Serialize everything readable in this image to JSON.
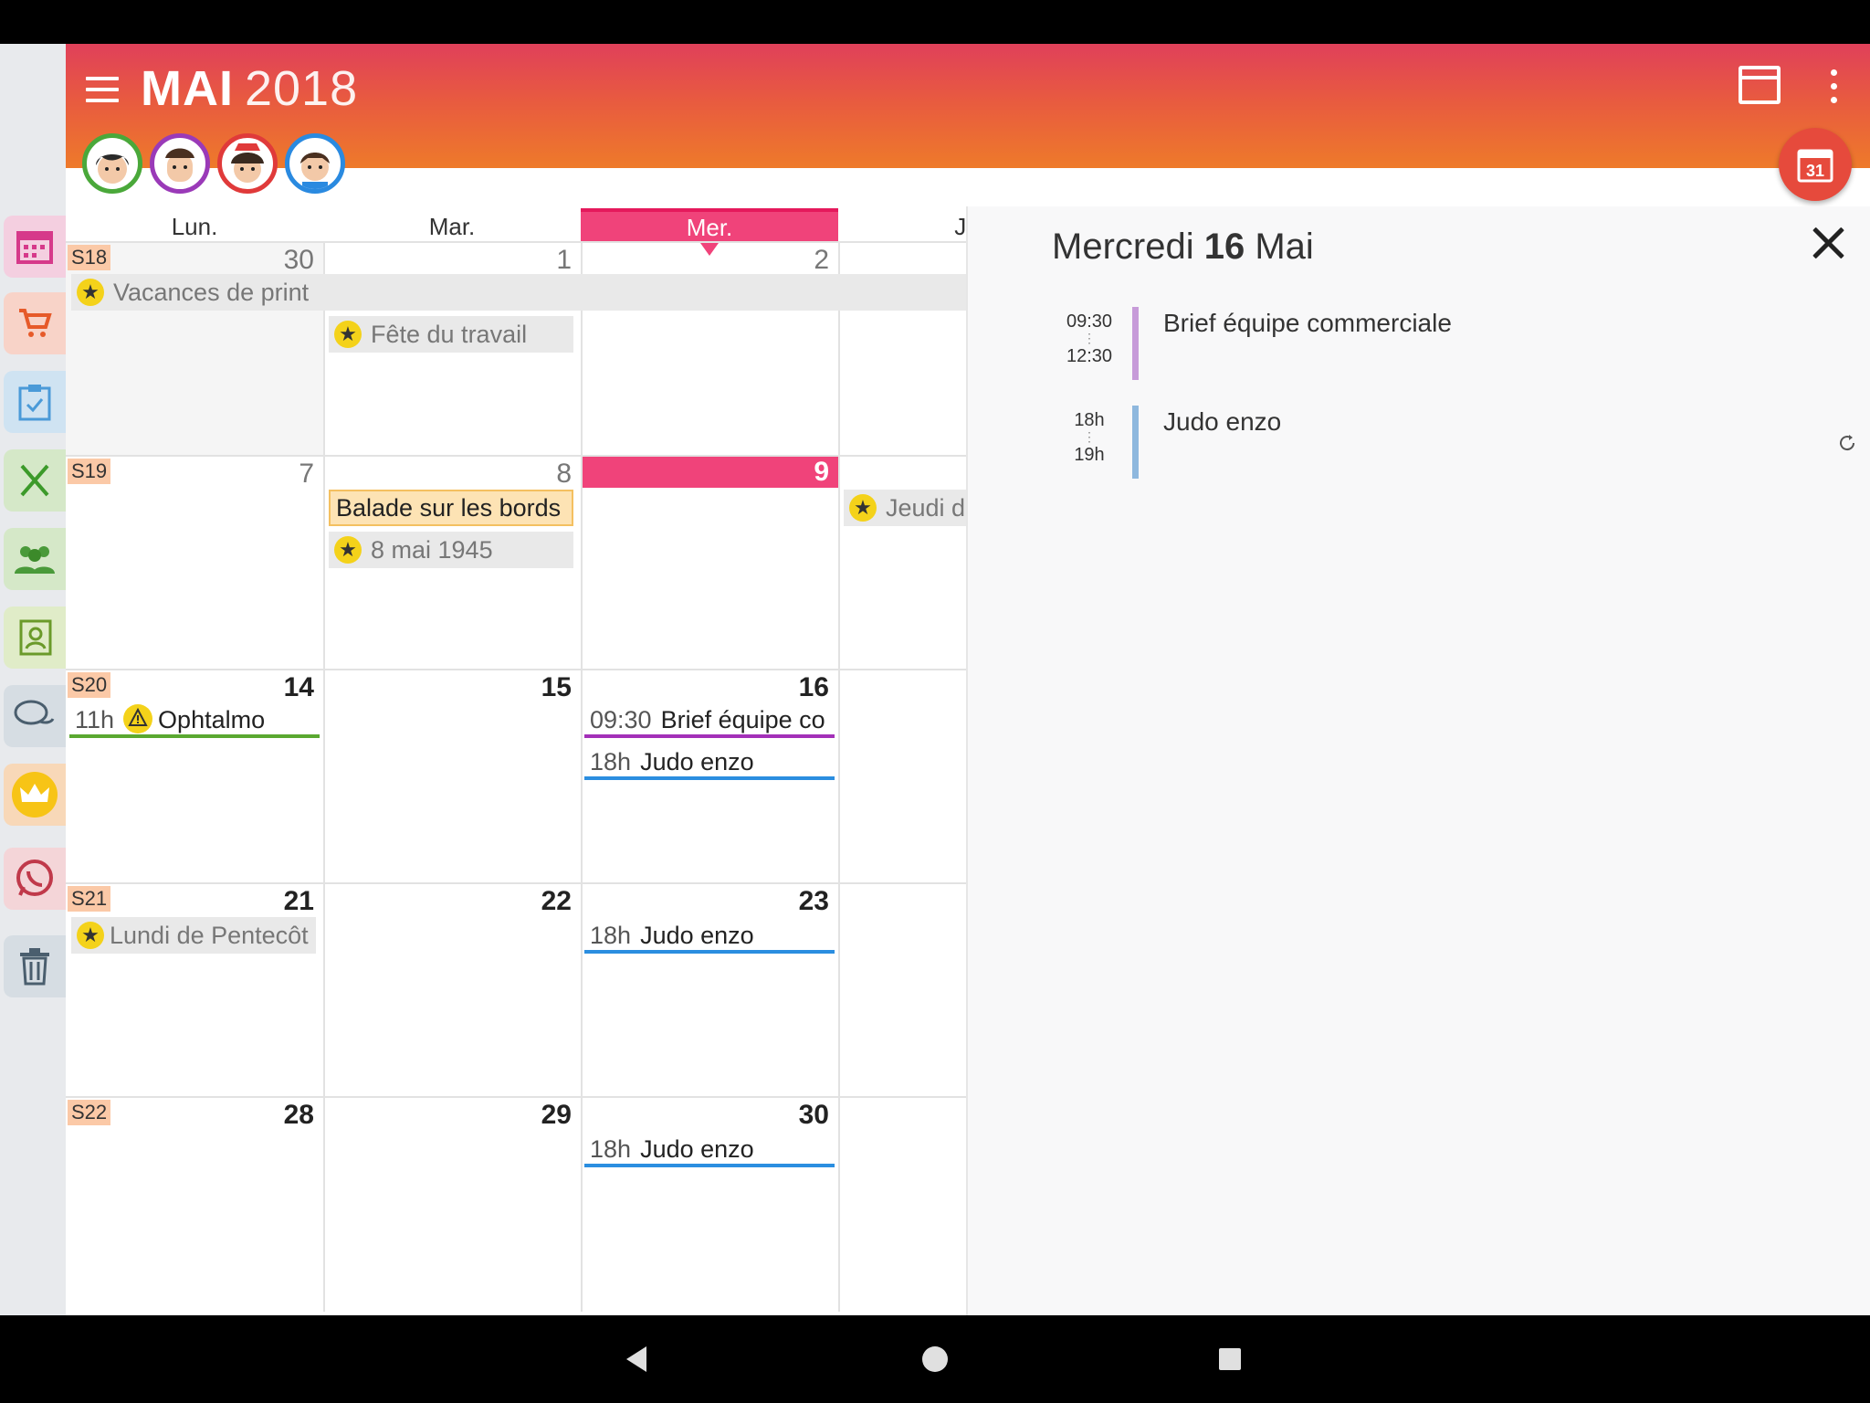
{
  "header": {
    "month": "MAI",
    "year": "2018"
  },
  "fab_calendar_day": "31",
  "day_headers": [
    "Lun.",
    "Mar.",
    "Mer.",
    "Je"
  ],
  "weeks": [
    {
      "label": "S18",
      "days": [
        "30",
        "1",
        "2",
        ""
      ]
    },
    {
      "label": "S19",
      "days": [
        "7",
        "8",
        "9",
        ""
      ]
    },
    {
      "label": "S20",
      "days": [
        "14",
        "15",
        "16",
        ""
      ]
    },
    {
      "label": "S21",
      "days": [
        "21",
        "22",
        "23",
        ""
      ]
    },
    {
      "label": "S22",
      "days": [
        "28",
        "29",
        "30",
        ""
      ]
    }
  ],
  "events": {
    "vacances": "Vacances de print",
    "fete_travail": "Fête du travail",
    "balade": "Balade sur les bords",
    "mai1945": "8 mai 1945",
    "jeudi": "Jeudi d",
    "ophtalmo_time": "11h",
    "ophtalmo": "Ophtalmo",
    "brief_time": "09:30",
    "brief": "Brief équipe co",
    "judo_time": "18h",
    "judo": "Judo enzo",
    "pentecote": "Lundi de Pentecôt"
  },
  "panel": {
    "title_weekday": "Mercredi",
    "title_day": "16",
    "title_month": "Mai",
    "items": [
      {
        "start": "09:30",
        "end": "12:30",
        "label": "Brief équipe commerciale",
        "color": "#c79bd9"
      },
      {
        "start": "18h",
        "end": "19h",
        "label": "Judo enzo",
        "color": "#8fb8de"
      }
    ]
  },
  "colors": {
    "today_accent": "#f0437a",
    "fab": "#e64a3c",
    "ophtalmo_line": "#5aa830",
    "brief_line": "#a330b8",
    "judo_line": "#2b8ee0"
  },
  "icons": {
    "sidebar": [
      "calendar-icon",
      "cart-icon",
      "clipboard-check-icon",
      "fork-knife-icon",
      "people-icon",
      "contact-book-icon",
      "chat-icon",
      "crown-icon",
      "whatsapp-icon",
      "trash-icon"
    ]
  }
}
